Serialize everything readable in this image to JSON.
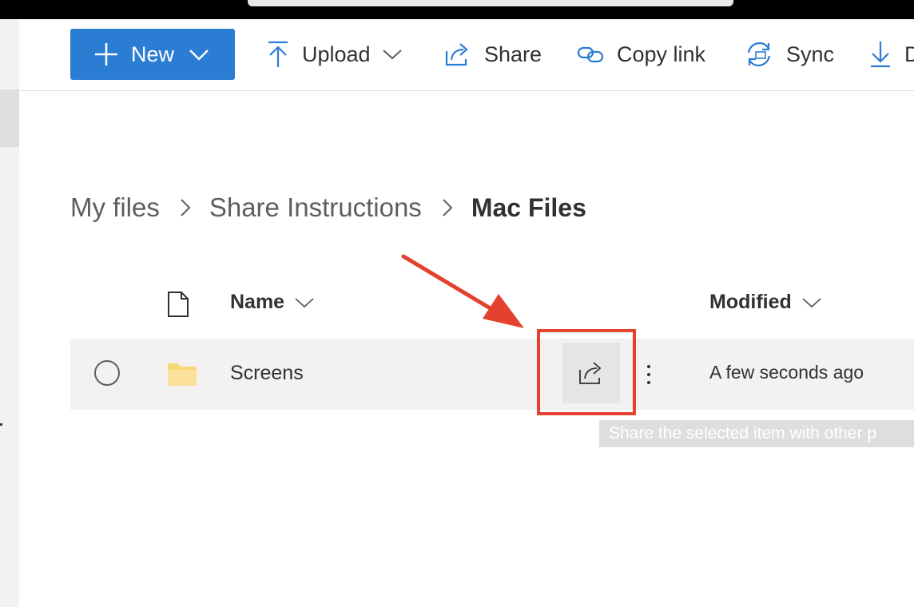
{
  "command_bar": {
    "new_label": "New",
    "upload_label": "Upload",
    "share_label": "Share",
    "copy_link_label": "Copy link",
    "sync_label": "Sync",
    "download_label": "D"
  },
  "breadcrumb": {
    "items": [
      "My files",
      "Share Instructions"
    ],
    "current": "Mac Files"
  },
  "list": {
    "columns": {
      "name": "Name",
      "modified": "Modified"
    },
    "rows": [
      {
        "name": "Screens",
        "modified": "A few seconds ago",
        "type": "folder"
      }
    ]
  },
  "tooltip": {
    "text": "Share the selected item with other p"
  },
  "colors": {
    "accent": "#2b7cd3",
    "annotation": "#e5412f",
    "folder": "#f8d775",
    "row_selected": "#f3f2f1"
  },
  "icons": {
    "new": "plus-icon",
    "upload": "upload-icon",
    "share": "share-icon",
    "copy_link": "link-icon",
    "sync": "sync-icon",
    "download": "download-icon"
  }
}
